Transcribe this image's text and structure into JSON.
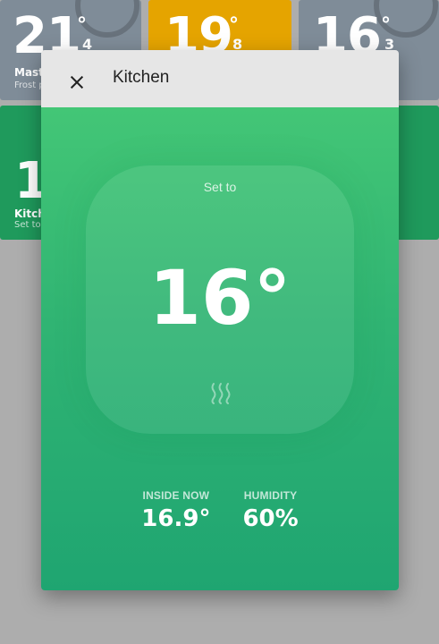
{
  "tiles": [
    {
      "temp": "21",
      "degree": "°",
      "decimal": "4",
      "name": "Maste",
      "sub": "Frost p",
      "color": "#7f8c98"
    },
    {
      "temp": "19",
      "degree": "°",
      "decimal": "8",
      "name": "",
      "sub": "",
      "color": "#e5a400"
    },
    {
      "temp": "16",
      "degree": "°",
      "decimal": "3",
      "name": "",
      "sub": "",
      "color": "#7f8c98"
    },
    {
      "temp": "1",
      "degree": "",
      "decimal": "",
      "name": "Kitch",
      "sub": "Set to",
      "color": "#1f9a5c"
    }
  ],
  "modal": {
    "title": "Kitchen",
    "set_label": "Set to",
    "set_temp": "16°",
    "mode_icon": "heat-waves-icon",
    "stats": [
      {
        "label": "INSIDE NOW",
        "value": "16.9°"
      },
      {
        "label": "HUMIDITY",
        "value": "60%"
      }
    ]
  },
  "colors": {
    "accent_green": "#30b473",
    "header_bg": "#e6e6e6",
    "backdrop": "#adadad"
  }
}
